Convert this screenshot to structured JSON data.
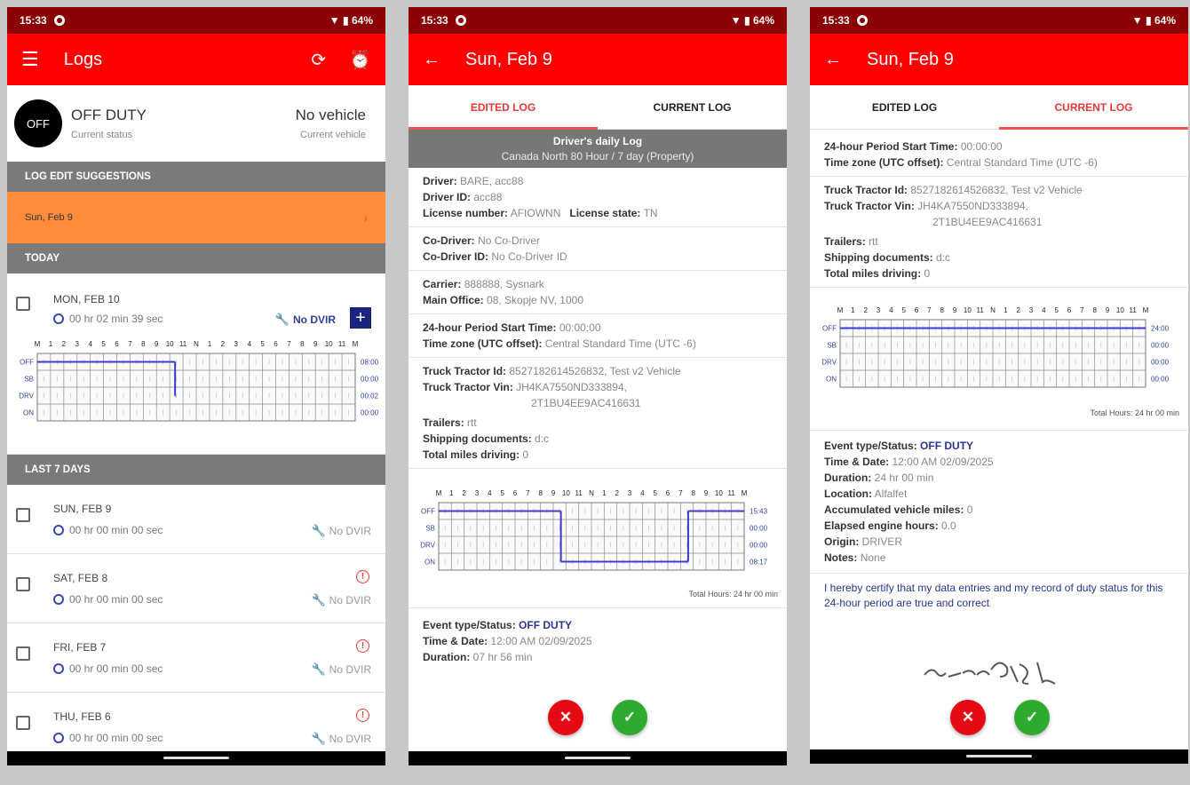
{
  "status_bar": {
    "time": "15:33",
    "battery": "64%"
  },
  "screen1": {
    "title": "Logs",
    "status": {
      "badge": "OFF",
      "main": "OFF DUTY",
      "sub": "Current status",
      "vehicle": "No vehicle",
      "vehicle_sub": "Current vehicle"
    },
    "suggestions_header": "LOG EDIT SUGGESTIONS",
    "suggestion_item": "Sun, Feb 9",
    "today_header": "TODAY",
    "today": {
      "title": "MON, FEB 10",
      "time": "00 hr 02 min 39 sec",
      "dvir": "No DVIR",
      "totals": [
        "08:00",
        "00:00",
        "00:02",
        "00:00"
      ]
    },
    "last7_header": "LAST 7 DAYS",
    "days": [
      {
        "title": "SUN, FEB 9",
        "time": "00 hr 00 min 00 sec",
        "dvir": "No DVIR",
        "warn": false
      },
      {
        "title": "SAT, FEB 8",
        "time": "00 hr 00 min 00 sec",
        "dvir": "No DVIR",
        "warn": true
      },
      {
        "title": "FRI, FEB 7",
        "time": "00 hr 00 min 00 sec",
        "dvir": "No DVIR",
        "warn": true
      },
      {
        "title": "THU, FEB 6",
        "time": "00 hr 00 min 00 sec",
        "dvir": "No DVIR",
        "warn": true
      }
    ]
  },
  "screen2": {
    "title": "Sun, Feb 9",
    "tabs": [
      "EDITED LOG",
      "CURRENT LOG"
    ],
    "card_title": "Driver's daily Log",
    "card_sub": "Canada North 80 Hour / 7 day (Property)",
    "driver": {
      "l_driver": "Driver:",
      "v_driver": "BARE, acc88",
      "l_id": "Driver ID:",
      "v_id": "acc88",
      "l_lic": "License number:",
      "v_lic": "AFIOWNN",
      "l_state": "License state:",
      "v_state": "TN"
    },
    "codriver": {
      "l_name": "Co-Driver:",
      "v_name": "No Co-Driver",
      "l_id": "Co-Driver ID:",
      "v_id": "No Co-Driver ID"
    },
    "carrier": {
      "l_carrier": "Carrier:",
      "v_carrier": "888888, Sysnark",
      "l_office": "Main Office:",
      "v_office": "08, Skopje NV, 1000"
    },
    "period": {
      "l_start": "24-hour Period Start Time:",
      "v_start": "00:00:00",
      "l_tz": "Time zone (UTC offset):",
      "v_tz": "Central Standard Time (UTC -6)"
    },
    "truck": {
      "l_id": "Truck Tractor Id:",
      "v_id": "8527182614526832, Test v2 Vehicle",
      "l_vin": "Truck Tractor Vin:",
      "v_vin1": "JH4KA7550ND333894,",
      "v_vin2": "2T1BU4EE9AC416631",
      "l_trailers": "Trailers:",
      "v_trailers": "rtt",
      "l_ship": "Shipping documents:",
      "v_ship": "d:c",
      "l_miles": "Total miles driving:",
      "v_miles": "0"
    },
    "totals": [
      "15:43",
      "00:00",
      "00:00",
      "08:17"
    ],
    "total_hours": "Total Hours: 24 hr 00 min",
    "event": {
      "l_type": "Event type/Status:",
      "v_type": "OFF DUTY",
      "l_date": "Time & Date:",
      "v_date": "12:00 AM 02/09/2025",
      "l_dur": "Duration:",
      "v_dur": "07 hr 56 min"
    }
  },
  "screen3": {
    "title": "Sun, Feb 9",
    "tabs": [
      "EDITED LOG",
      "CURRENT LOG"
    ],
    "period": {
      "l_start": "24-hour Period Start Time:",
      "v_start": "00:00:00",
      "l_tz": "Time zone (UTC offset):",
      "v_tz": "Central Standard Time (UTC -6)"
    },
    "truck": {
      "l_id": "Truck Tractor Id:",
      "v_id": "8527182614526832, Test v2 Vehicle",
      "l_vin": "Truck Tractor Vin:",
      "v_vin1": "JH4KA7550ND333894,",
      "v_vin2": "2T1BU4EE9AC416631",
      "l_trailers": "Trailers:",
      "v_trailers": "rtt",
      "l_ship": "Shipping documents:",
      "v_ship": "d:c",
      "l_miles": "Total miles driving:",
      "v_miles": "0"
    },
    "totals": [
      "24:00",
      "00:00",
      "00:00",
      "00:00"
    ],
    "total_hours": "Total Hours: 24 hr 00 min",
    "event": {
      "l_type": "Event type/Status:",
      "v_type": "OFF DUTY",
      "l_date": "Time & Date:",
      "v_date": "12:00 AM 02/09/2025",
      "l_dur": "Duration:",
      "v_dur": "24 hr 00 min",
      "l_loc": "Location:",
      "v_loc": "Alfalfet",
      "l_acc": "Accumulated vehicle miles:",
      "v_acc": "0",
      "l_eng": "Elapsed engine hours:",
      "v_eng": "0.0",
      "l_origin": "Origin:",
      "v_origin": "DRIVER",
      "l_notes": "Notes:",
      "v_notes": "None"
    },
    "certify": "I hereby certify that my data entries and my record of duty status for this 24-hour period are true and correct"
  },
  "grid": {
    "hour_labels": [
      "M",
      "1",
      "2",
      "3",
      "4",
      "5",
      "6",
      "7",
      "8",
      "9",
      "10",
      "11",
      "N",
      "1",
      "2",
      "3",
      "4",
      "5",
      "6",
      "7",
      "8",
      "9",
      "10",
      "11",
      "M"
    ],
    "row_labels": [
      "OFF",
      "SB",
      "DRV",
      "ON"
    ]
  },
  "colors": {
    "primary": "#ff0000",
    "statusbar": "#8b0000",
    "suggestion": "#ff8c3a",
    "line": "#3a3ad0"
  }
}
